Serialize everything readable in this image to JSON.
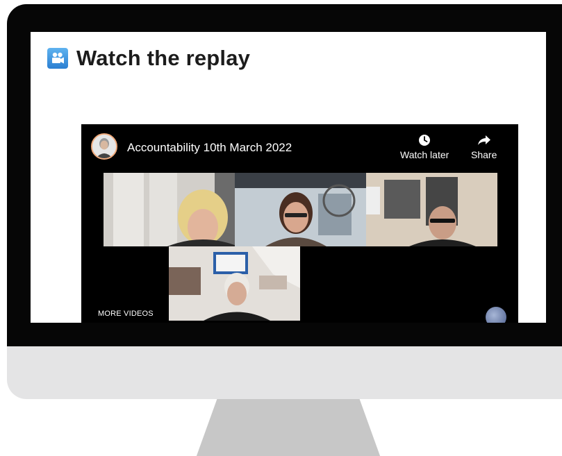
{
  "heading": {
    "icon": "movie-camera-icon",
    "title": "Watch the replay"
  },
  "player": {
    "video_title": "Accountability 10th March 2022",
    "channel_avatar": "presenter-avatar",
    "actions": [
      {
        "label": "Watch later",
        "icon": "clock-icon"
      },
      {
        "label": "Share",
        "icon": "share-arrow-icon"
      }
    ],
    "more_videos_label": "MORE VIDEOS",
    "participants": [
      "participant-1",
      "participant-2",
      "participant-3",
      "participant-4"
    ]
  },
  "colors": {
    "bezel": "#060606",
    "chin": "#e4e4e5",
    "stand": "#c7c7c7",
    "player_bg": "#000000",
    "icon_blue": "#2b7fd2"
  }
}
